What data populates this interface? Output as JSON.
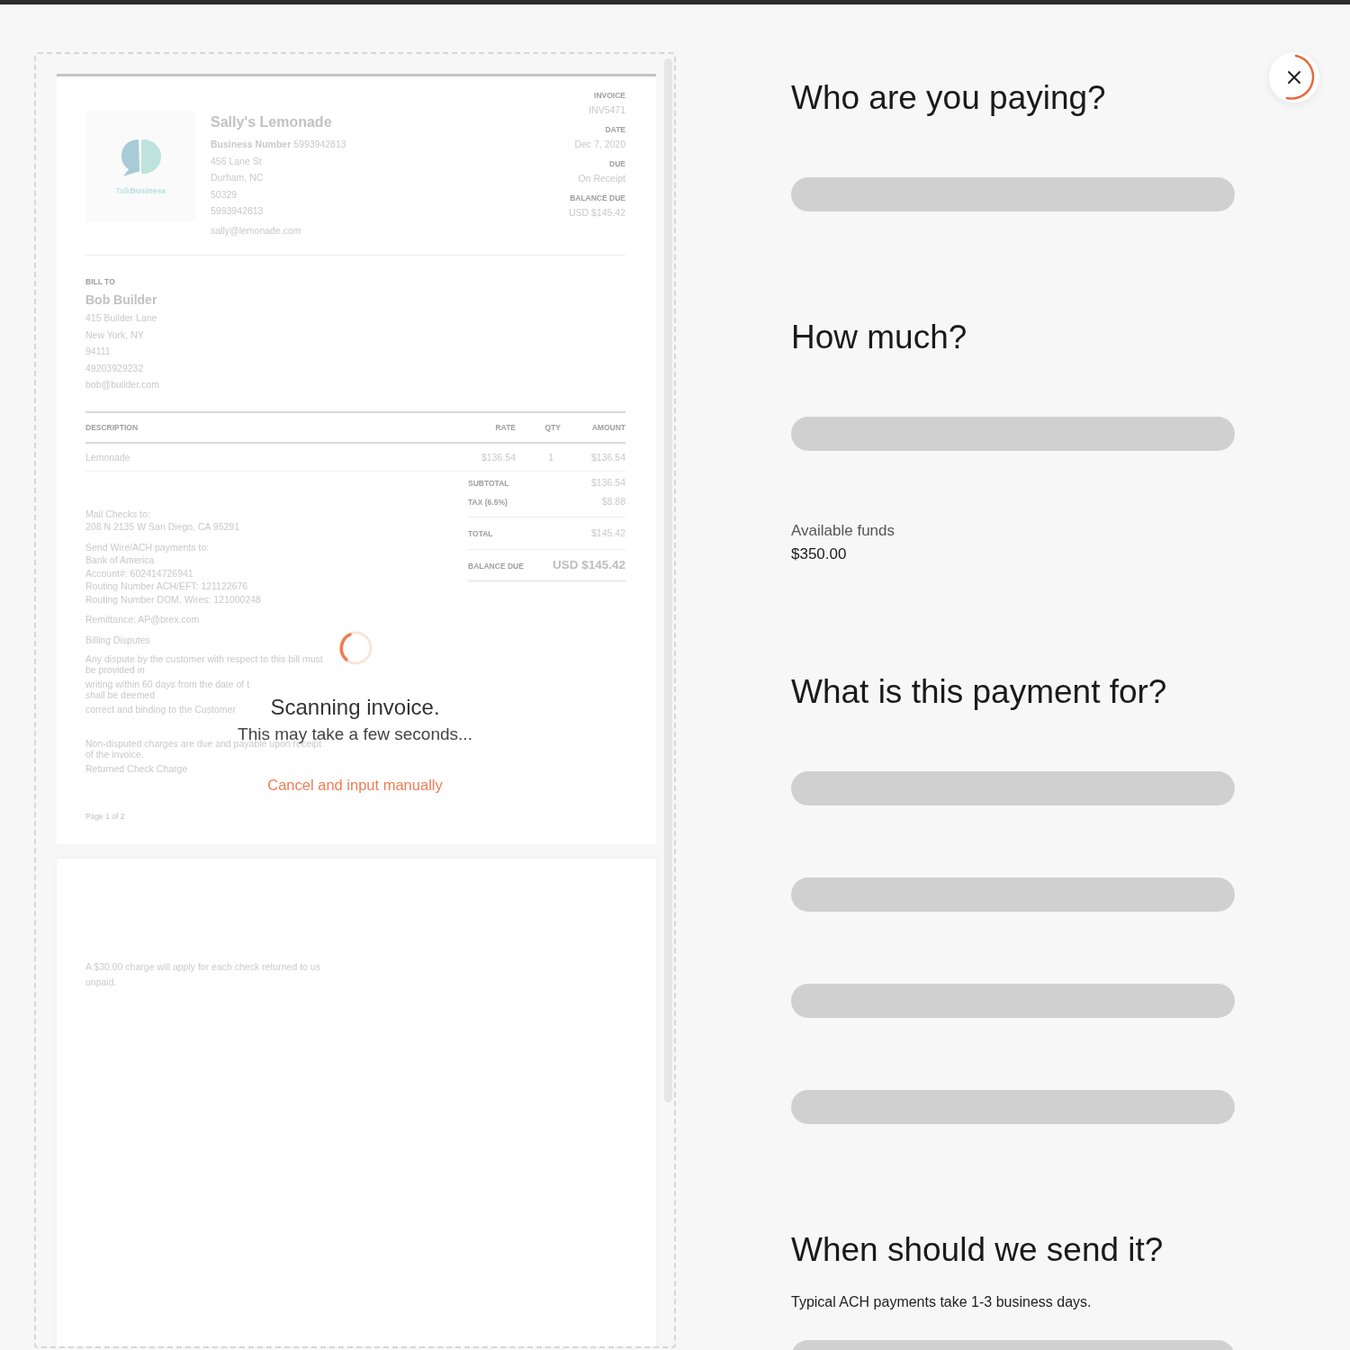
{
  "invoice": {
    "logo_text": "Talk**Business**",
    "company": {
      "name": "Sally's Lemonade",
      "business_number": "**Business Number** 5993942813",
      "lines": [
        "456 Lane St",
        "Durham, NC",
        "50329",
        "5993942813",
        "sally@lemonade.com"
      ]
    },
    "meta": [
      {
        "label": "INVOICE",
        "value": "INV5471"
      },
      {
        "label": "DATE",
        "value": "Dec 7, 2020"
      },
      {
        "label": "DUE",
        "value": "On Receipt"
      },
      {
        "label": "BALANCE DUE",
        "value": "USD $145.42"
      }
    ],
    "bill_to": {
      "label": "BILL TO",
      "name": "Bob Builder",
      "lines": [
        "415 Builder Lane",
        "New York, NY",
        "94111",
        "49203929232",
        "bob@builder.com"
      ]
    },
    "table": {
      "columns": [
        "DESCRIPTION",
        "RATE",
        "QTY",
        "AMOUNT"
      ],
      "rows": [
        [
          "Lemonade",
          "$136.54",
          "1",
          "$136.54"
        ]
      ]
    },
    "totals": [
      {
        "label": "SUBTOTAL",
        "value": "$136.54",
        "kind": "plain"
      },
      {
        "label": "TAX (6.5%)",
        "value": "$8.88",
        "kind": "plain"
      },
      {
        "label": "TOTAL",
        "value": "$145.42",
        "kind": "ruled"
      },
      {
        "label": "BALANCE DUE",
        "value": "USD $145.42",
        "kind": "emphasis"
      }
    ],
    "notes": [
      [
        "Mail Checks to:",
        "208 N 2135 W San Diego, CA 95291"
      ],
      [
        "Send Wire/ACH payments to:",
        "Bank of America",
        "Account#: 602414726941",
        "Routing Number ACH/EFT: 121122676",
        "Routing Number DOM. Wires: 121000248"
      ],
      [
        "Remittance: AP@brex.com"
      ],
      [
        "Billing Disputes"
      ],
      [
        "Any dispute by the customer with respect to this bill must",
        "be provided in"
      ],
      [
        "writing within 60 days from the date of t",
        "shall be deemed"
      ],
      [
        "correct and binding to the Customer"
      ],
      [
        "Non-disputed charges are due and payable upon receipt",
        "of the invoice."
      ],
      [
        "Returned Check Charge"
      ]
    ],
    "page_footer": "Page 1 of 2",
    "page_2_text": "A $30.00 charge will apply for each check returned to us unpaid."
  },
  "scan_overlay": {
    "title": "Scanning invoice.",
    "subtitle": "This may take a few seconds...",
    "cancel_link": "Cancel and input manually"
  },
  "form": {
    "sections": [
      {
        "heading": "Who are you paying?",
        "items": [
          {
            "kind": "skeleton"
          }
        ]
      },
      {
        "heading": "How much?",
        "items": [
          {
            "kind": "skeleton"
          },
          {
            "kind": "info",
            "label": "Available funds",
            "value": "$350.00"
          }
        ]
      },
      {
        "heading": "What is this payment for?",
        "items": [
          {
            "kind": "skeleton"
          },
          {
            "kind": "skeleton"
          },
          {
            "kind": "skeleton"
          },
          {
            "kind": "skeleton"
          }
        ]
      },
      {
        "heading": "When should we send it?",
        "items": [
          {
            "kind": "note",
            "text": "Typical ACH payments take 1-3 business days."
          },
          {
            "kind": "skeleton"
          }
        ]
      }
    ]
  }
}
